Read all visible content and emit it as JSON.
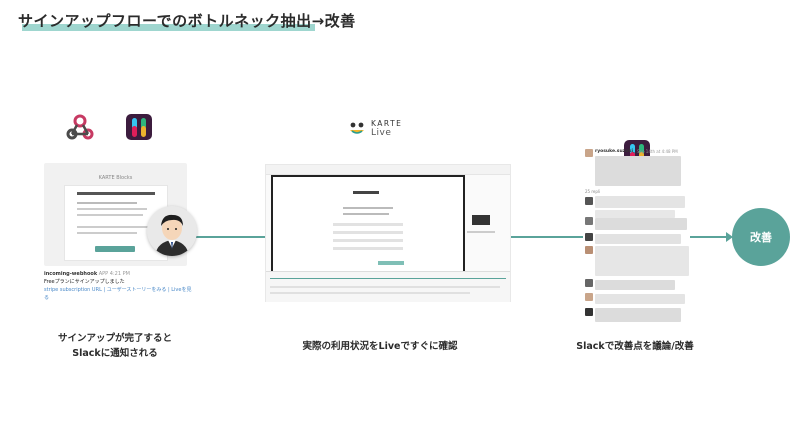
{
  "title": "サインアップフローでのボトルネック抽出→改善",
  "steps": [
    {
      "caption_line1": "サインアップが完了すると",
      "caption_line2": "Slackに通知される",
      "card_brand": "KARTE Blocks",
      "notification": {
        "sender": "incoming-webhook",
        "app_tag": "APP",
        "time": "4:21 PM",
        "message": "Freeプランにサインアップしました",
        "link_text": "stripe subscription URL | ユーザーストーリーをみる | Liveを見る"
      }
    },
    {
      "logo_text": "KARTE",
      "logo_sub": "Live",
      "caption": "実際の利用状況をLiveですぐに確認"
    },
    {
      "caption": "Slackで改善点を議論/改善",
      "thread_user": "ryosuke.suzuki_",
      "thread_time": "Sep 14th at 4:48 PM",
      "thread_replies": "25 repli"
    }
  ],
  "improve_label": "改善",
  "colors": {
    "accent": "#5aa39a",
    "underline": "#9fd6cf",
    "slack_bg": "#3c1c3e"
  },
  "icons": [
    "webhook-icon",
    "slack-icon",
    "karte-live-logo",
    "avatar-icon"
  ]
}
